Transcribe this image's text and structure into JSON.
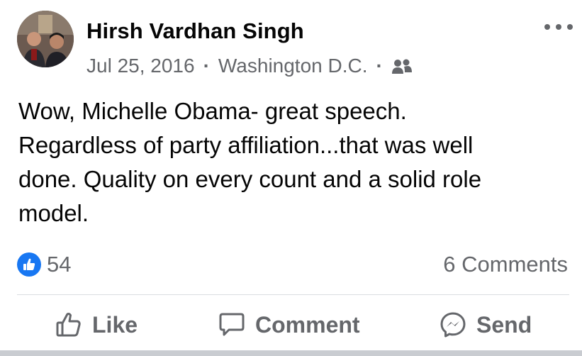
{
  "post": {
    "author": "Hirsh Vardhan Singh",
    "date": "Jul 25, 2016",
    "separator": "·",
    "location": "Washington D.C.",
    "audience_icon": "friends-icon",
    "text": "Wow, Michelle Obama- great speech.\nRegardless of party affiliation...that was well\ndone. Quality on every count and a solid role\nmodel.",
    "reaction_count": "54",
    "comments_count": "6 Comments"
  },
  "actions": {
    "like_label": "Like",
    "comment_label": "Comment",
    "send_label": "Send"
  },
  "colors": {
    "text": "#050505",
    "secondary": "#65676b",
    "accent": "#1877f2",
    "divider": "#dadde1"
  }
}
